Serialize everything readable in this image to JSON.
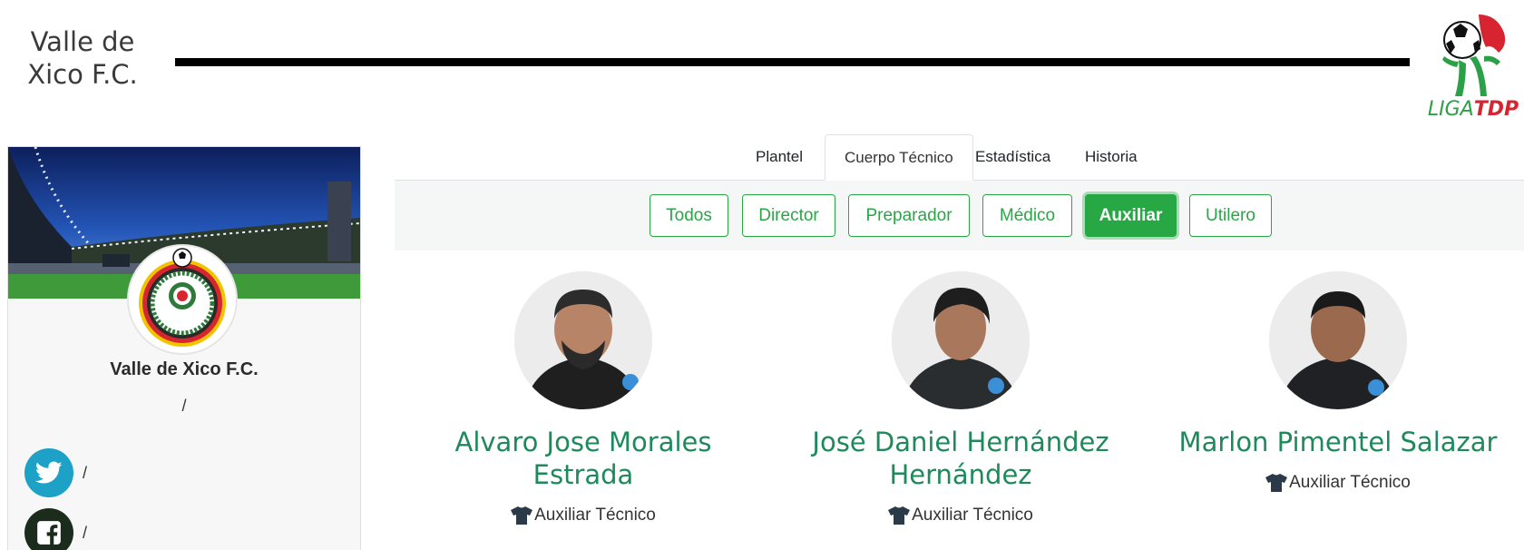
{
  "header": {
    "club_title": "Valle de Xico F.C.",
    "liga_prefix": "LIGA",
    "liga_suffix": "TDP"
  },
  "sidebar": {
    "team_name": "Valle de Xico F.C.",
    "subtitle": "/",
    "twitter_text": "/",
    "facebook_text": "/"
  },
  "tabs": [
    {
      "label": "Plantel",
      "active": false
    },
    {
      "label": "Cuerpo Técnico",
      "active": true
    },
    {
      "label": "Estadística",
      "active": false
    },
    {
      "label": "Historia",
      "active": false
    }
  ],
  "filters": [
    {
      "label": "Todos",
      "active": false
    },
    {
      "label": "Director",
      "active": false
    },
    {
      "label": "Preparador",
      "active": false
    },
    {
      "label": "Médico",
      "active": false
    },
    {
      "label": "Auxiliar",
      "active": true
    },
    {
      "label": "Utilero",
      "active": false
    }
  ],
  "staff": [
    {
      "name": "Alvaro Jose Morales Estrada",
      "role": "Auxiliar Técnico"
    },
    {
      "name": "José Daniel Hernández Hernández",
      "role": "Auxiliar Técnico"
    },
    {
      "name": "Marlon Pimentel Salazar",
      "role": "Auxiliar Técnico"
    }
  ],
  "colors": {
    "accent_green": "#28a745",
    "name_green": "#1e8a5b",
    "twitter": "#1da1c6",
    "facebook": "#1c2c1c"
  },
  "icons": [
    "twitter-icon",
    "facebook-icon",
    "shirt-icon",
    "liga-tdp-logo"
  ]
}
